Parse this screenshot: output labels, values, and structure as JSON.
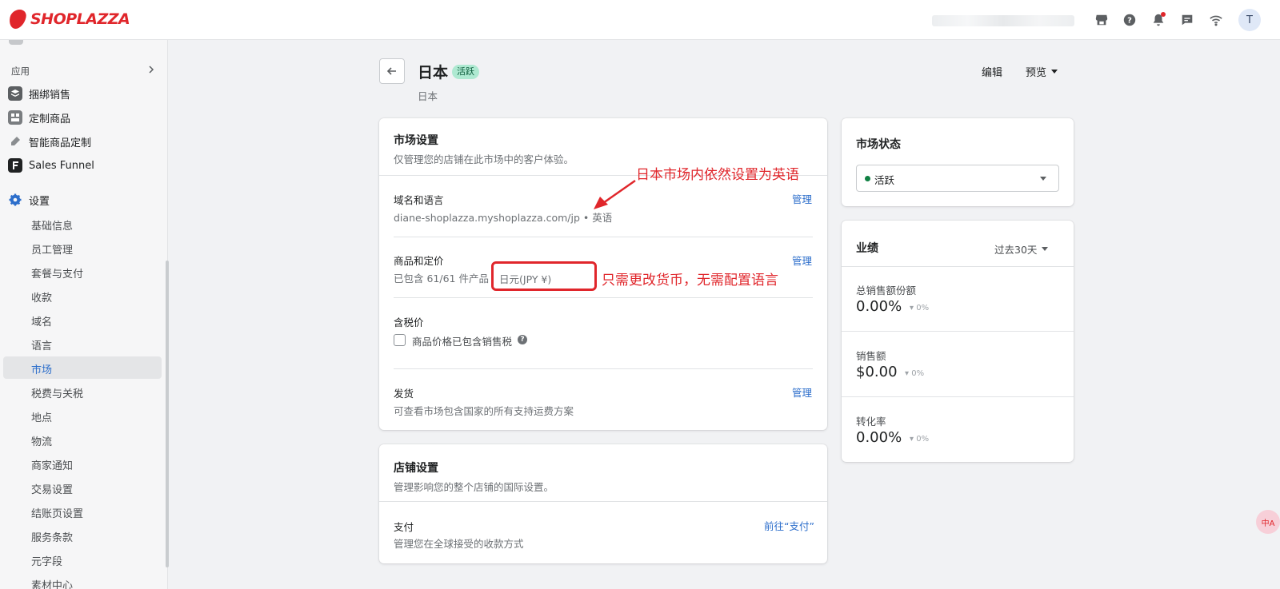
{
  "brand": {
    "name": "SHOPLAZZA",
    "color": "#e0262b"
  },
  "topbar": {
    "icons": [
      "store-icon",
      "help-icon",
      "bell-icon",
      "chat-icon",
      "wifi-icon"
    ],
    "avatar_initial": "T"
  },
  "sidebar": {
    "section_label": "应用",
    "apps": [
      {
        "label": "捆绑销售",
        "icon": "layers-icon"
      },
      {
        "label": "定制商品",
        "icon": "customize-icon"
      },
      {
        "label": "智能商品定制",
        "icon": "pen-icon"
      },
      {
        "label": "Sales Funnel",
        "icon": "funnel-icon"
      }
    ],
    "settings_label": "设置",
    "settings_items": [
      "基础信息",
      "员工管理",
      "套餐与支付",
      "收款",
      "域名",
      "语言",
      "市场",
      "税费与关税",
      "地点",
      "物流",
      "商家通知",
      "交易设置",
      "结账页设置",
      "服务条款",
      "元字段",
      "素材中心"
    ],
    "active_item": "市场"
  },
  "page": {
    "title": "日本",
    "status_badge": "活跃",
    "subtitle": "日本",
    "edit_label": "编辑",
    "preview_label": "预览"
  },
  "market_settings": {
    "title": "市场设置",
    "description": "仅管理您的店铺在此市场中的客户体验。",
    "domain": {
      "title": "域名和语言",
      "value": "diane-shoplazza.myshoplazza.com/jp • 英语",
      "action": "管理"
    },
    "products": {
      "title": "商品和定价",
      "value": "已包含 61/61 件产品",
      "currency": "日元(JPY ¥)",
      "action": "管理"
    },
    "tax": {
      "title": "含税价",
      "checkbox_label": "商品价格已包含销售税"
    },
    "shipping": {
      "title": "发货",
      "value": "可查看市场包含国家的所有支持运费方案",
      "action": "管理"
    }
  },
  "store_settings": {
    "title": "店铺设置",
    "description": "管理影响您的整个店铺的国际设置。",
    "payment": {
      "title": "支付",
      "value": "管理您在全球接受的收款方式",
      "action": "前往“支付”"
    }
  },
  "annotations": {
    "language_note": "日本市场内依然设置为英语",
    "currency_note": "只需更改货币，无需配置语言"
  },
  "market_status": {
    "title": "市场状态",
    "value": "活跃"
  },
  "performance": {
    "title": "业绩",
    "range": "过去30天",
    "metrics": [
      {
        "label": "总销售额份额",
        "value": "0.00%",
        "delta": "0%"
      },
      {
        "label": "销售额",
        "value": "$0.00",
        "delta": "0%"
      },
      {
        "label": "转化率",
        "value": "0.00%",
        "delta": "0%"
      }
    ]
  },
  "translate_button": "中A"
}
